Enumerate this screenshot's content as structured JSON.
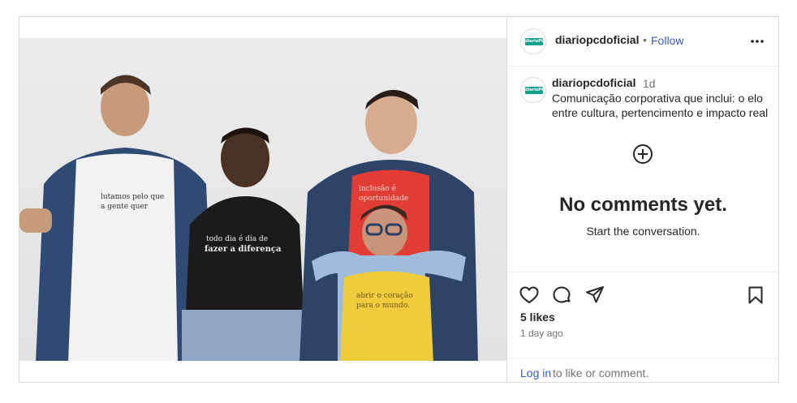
{
  "header": {
    "username": "diariopcdoficial",
    "separator": "•",
    "follow_label": "Follow",
    "avatar_logo_text": "diarioPCD"
  },
  "caption": {
    "username": "diariopcdoficial",
    "time": "1d",
    "text": "Comunicação corporativa que inclui: o elo entre cultura, pertencimento e impacto real"
  },
  "comments": {
    "empty_title": "No comments yet.",
    "empty_subtitle": "Start the conversation."
  },
  "engagement": {
    "likes": "5 likes",
    "date": "1 day ago"
  },
  "login": {
    "link": "Log in",
    "rest": "to like or comment."
  },
  "photo": {
    "shirt_texts": [
      "lutamos pelo que a gente quer",
      "todo dia é dia de fazer a diferença",
      "inclusão é oportunidade",
      "abrir o coração para o mundo"
    ]
  },
  "icons": {
    "more": "more-options-icon",
    "add": "add-comment-icon",
    "like": "heart-icon",
    "comment": "comment-icon",
    "share": "share-icon",
    "save": "bookmark-icon"
  },
  "colors": {
    "link": "#3b5bbf",
    "text": "#262626",
    "muted": "#737373",
    "border": "#dbdbdb"
  }
}
